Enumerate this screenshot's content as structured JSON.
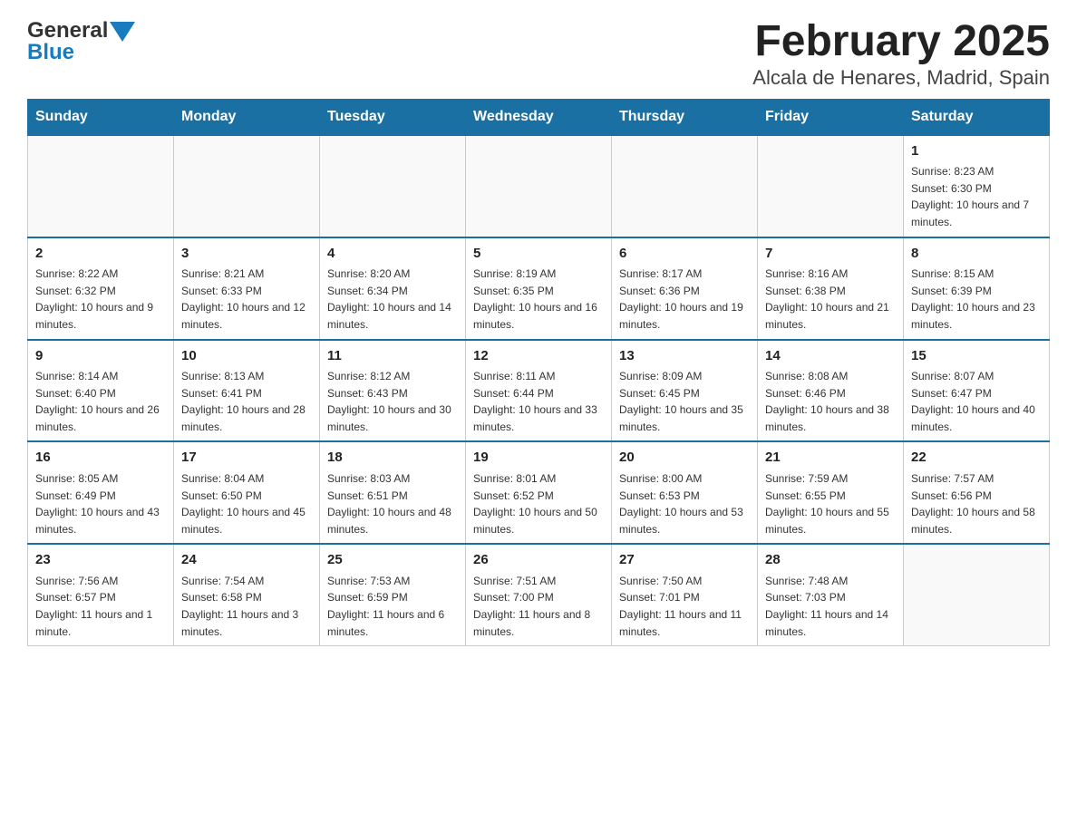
{
  "header": {
    "title": "February 2025",
    "subtitle": "Alcala de Henares, Madrid, Spain",
    "logo_general": "General",
    "logo_blue": "Blue"
  },
  "days_of_week": [
    "Sunday",
    "Monday",
    "Tuesday",
    "Wednesday",
    "Thursday",
    "Friday",
    "Saturday"
  ],
  "weeks": [
    {
      "days": [
        {
          "date": "",
          "info": ""
        },
        {
          "date": "",
          "info": ""
        },
        {
          "date": "",
          "info": ""
        },
        {
          "date": "",
          "info": ""
        },
        {
          "date": "",
          "info": ""
        },
        {
          "date": "",
          "info": ""
        },
        {
          "date": "1",
          "info": "Sunrise: 8:23 AM\nSunset: 6:30 PM\nDaylight: 10 hours and 7 minutes."
        }
      ]
    },
    {
      "days": [
        {
          "date": "2",
          "info": "Sunrise: 8:22 AM\nSunset: 6:32 PM\nDaylight: 10 hours and 9 minutes."
        },
        {
          "date": "3",
          "info": "Sunrise: 8:21 AM\nSunset: 6:33 PM\nDaylight: 10 hours and 12 minutes."
        },
        {
          "date": "4",
          "info": "Sunrise: 8:20 AM\nSunset: 6:34 PM\nDaylight: 10 hours and 14 minutes."
        },
        {
          "date": "5",
          "info": "Sunrise: 8:19 AM\nSunset: 6:35 PM\nDaylight: 10 hours and 16 minutes."
        },
        {
          "date": "6",
          "info": "Sunrise: 8:17 AM\nSunset: 6:36 PM\nDaylight: 10 hours and 19 minutes."
        },
        {
          "date": "7",
          "info": "Sunrise: 8:16 AM\nSunset: 6:38 PM\nDaylight: 10 hours and 21 minutes."
        },
        {
          "date": "8",
          "info": "Sunrise: 8:15 AM\nSunset: 6:39 PM\nDaylight: 10 hours and 23 minutes."
        }
      ]
    },
    {
      "days": [
        {
          "date": "9",
          "info": "Sunrise: 8:14 AM\nSunset: 6:40 PM\nDaylight: 10 hours and 26 minutes."
        },
        {
          "date": "10",
          "info": "Sunrise: 8:13 AM\nSunset: 6:41 PM\nDaylight: 10 hours and 28 minutes."
        },
        {
          "date": "11",
          "info": "Sunrise: 8:12 AM\nSunset: 6:43 PM\nDaylight: 10 hours and 30 minutes."
        },
        {
          "date": "12",
          "info": "Sunrise: 8:11 AM\nSunset: 6:44 PM\nDaylight: 10 hours and 33 minutes."
        },
        {
          "date": "13",
          "info": "Sunrise: 8:09 AM\nSunset: 6:45 PM\nDaylight: 10 hours and 35 minutes."
        },
        {
          "date": "14",
          "info": "Sunrise: 8:08 AM\nSunset: 6:46 PM\nDaylight: 10 hours and 38 minutes."
        },
        {
          "date": "15",
          "info": "Sunrise: 8:07 AM\nSunset: 6:47 PM\nDaylight: 10 hours and 40 minutes."
        }
      ]
    },
    {
      "days": [
        {
          "date": "16",
          "info": "Sunrise: 8:05 AM\nSunset: 6:49 PM\nDaylight: 10 hours and 43 minutes."
        },
        {
          "date": "17",
          "info": "Sunrise: 8:04 AM\nSunset: 6:50 PM\nDaylight: 10 hours and 45 minutes."
        },
        {
          "date": "18",
          "info": "Sunrise: 8:03 AM\nSunset: 6:51 PM\nDaylight: 10 hours and 48 minutes."
        },
        {
          "date": "19",
          "info": "Sunrise: 8:01 AM\nSunset: 6:52 PM\nDaylight: 10 hours and 50 minutes."
        },
        {
          "date": "20",
          "info": "Sunrise: 8:00 AM\nSunset: 6:53 PM\nDaylight: 10 hours and 53 minutes."
        },
        {
          "date": "21",
          "info": "Sunrise: 7:59 AM\nSunset: 6:55 PM\nDaylight: 10 hours and 55 minutes."
        },
        {
          "date": "22",
          "info": "Sunrise: 7:57 AM\nSunset: 6:56 PM\nDaylight: 10 hours and 58 minutes."
        }
      ]
    },
    {
      "days": [
        {
          "date": "23",
          "info": "Sunrise: 7:56 AM\nSunset: 6:57 PM\nDaylight: 11 hours and 1 minute."
        },
        {
          "date": "24",
          "info": "Sunrise: 7:54 AM\nSunset: 6:58 PM\nDaylight: 11 hours and 3 minutes."
        },
        {
          "date": "25",
          "info": "Sunrise: 7:53 AM\nSunset: 6:59 PM\nDaylight: 11 hours and 6 minutes."
        },
        {
          "date": "26",
          "info": "Sunrise: 7:51 AM\nSunset: 7:00 PM\nDaylight: 11 hours and 8 minutes."
        },
        {
          "date": "27",
          "info": "Sunrise: 7:50 AM\nSunset: 7:01 PM\nDaylight: 11 hours and 11 minutes."
        },
        {
          "date": "28",
          "info": "Sunrise: 7:48 AM\nSunset: 7:03 PM\nDaylight: 11 hours and 14 minutes."
        },
        {
          "date": "",
          "info": ""
        }
      ]
    }
  ]
}
